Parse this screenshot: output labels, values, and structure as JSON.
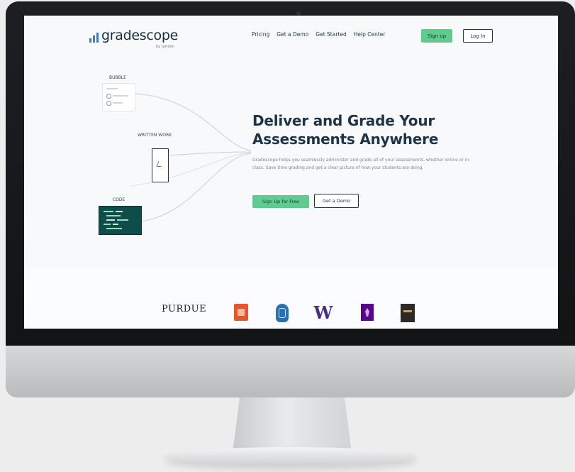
{
  "nav": {
    "logo_text": "gradescope",
    "logo_sub": "by turnitin",
    "links": [
      "Pricing",
      "Get a Demo",
      "Get Started",
      "Help Center"
    ],
    "signup_label": "Sign up",
    "login_label": "Log In"
  },
  "illustration": {
    "bubble_label": "Bubble",
    "written_label": "Written work",
    "code_label": "Code"
  },
  "hero": {
    "title": "Deliver and Grade Your Assessments Anywhere",
    "description": "Gradescope helps you seamlessly administer and grade all of your assessments, whether online or in class. Save time grading and get a clear picture of how your students are doing.",
    "primary_cta": "Sign Up for Free",
    "secondary_cta": "Get a Demo"
  },
  "logos": {
    "purdue": "PURDUE",
    "washington": "W"
  },
  "colors": {
    "accent_green": "#5fcb8e",
    "navy": "#1f3346",
    "code_bg": "#0f4d4a"
  }
}
